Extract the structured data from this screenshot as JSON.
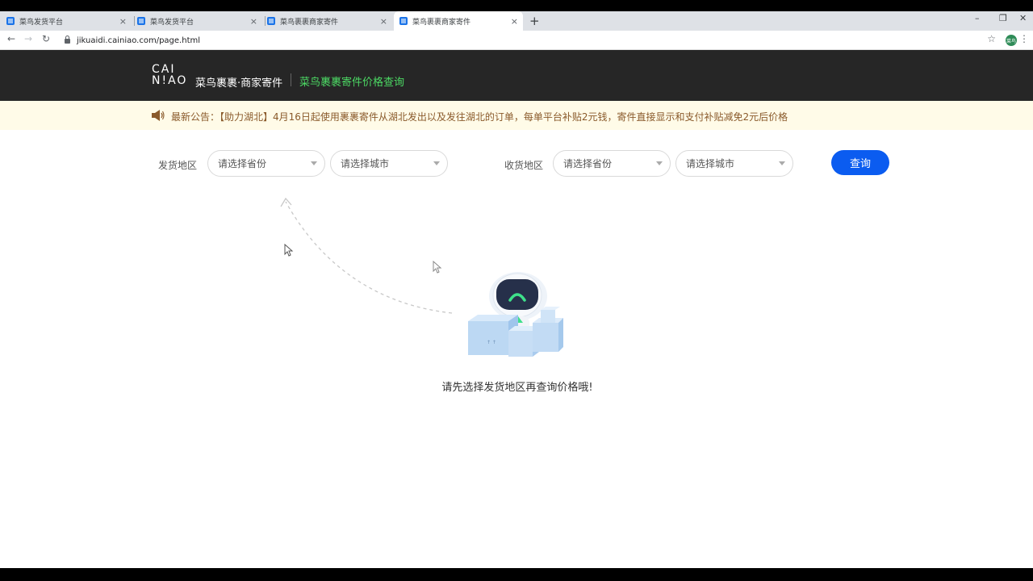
{
  "browser": {
    "tabs": [
      {
        "label": "菜鸟发货平台"
      },
      {
        "label": "菜鸟发货平台"
      },
      {
        "label": "菜鸟裹裹商家寄件"
      },
      {
        "label": "菜鸟裹裹商家寄件",
        "active": true
      }
    ],
    "close_glyph": "×",
    "new_tab_glyph": "+",
    "url": "jikuaidi.cainiao.com/page.html",
    "profile_initials": "菜鸟"
  },
  "header": {
    "logo_top": "CAI",
    "logo_bottom": "N!AO",
    "brand": "菜鸟裹裹·商家寄件",
    "title": "菜鸟裹裹寄件价格查询"
  },
  "notice": {
    "text": "最新公告：【助力湖北】4月16日起使用裹裹寄件从湖北发出以及发往湖北的订单，每单平台补贴2元钱，寄件直接显示和支付补贴减免2元后价格"
  },
  "filters": {
    "from_label": "发货地区",
    "from_province_placeholder": "请选择省份",
    "from_city_placeholder": "请选择城市",
    "to_label": "收货地区",
    "to_province_placeholder": "请选择省份",
    "to_city_placeholder": "请选择城市",
    "query_label": "查询"
  },
  "empty_state": {
    "message": "请先选择发货地区再查询价格哦!"
  },
  "colors": {
    "header_bg": "#262626",
    "title_green": "#4cd964",
    "notice_bg": "#fffbe8",
    "notice_text": "#8a5a2b",
    "primary_blue": "#0b5cf0"
  }
}
